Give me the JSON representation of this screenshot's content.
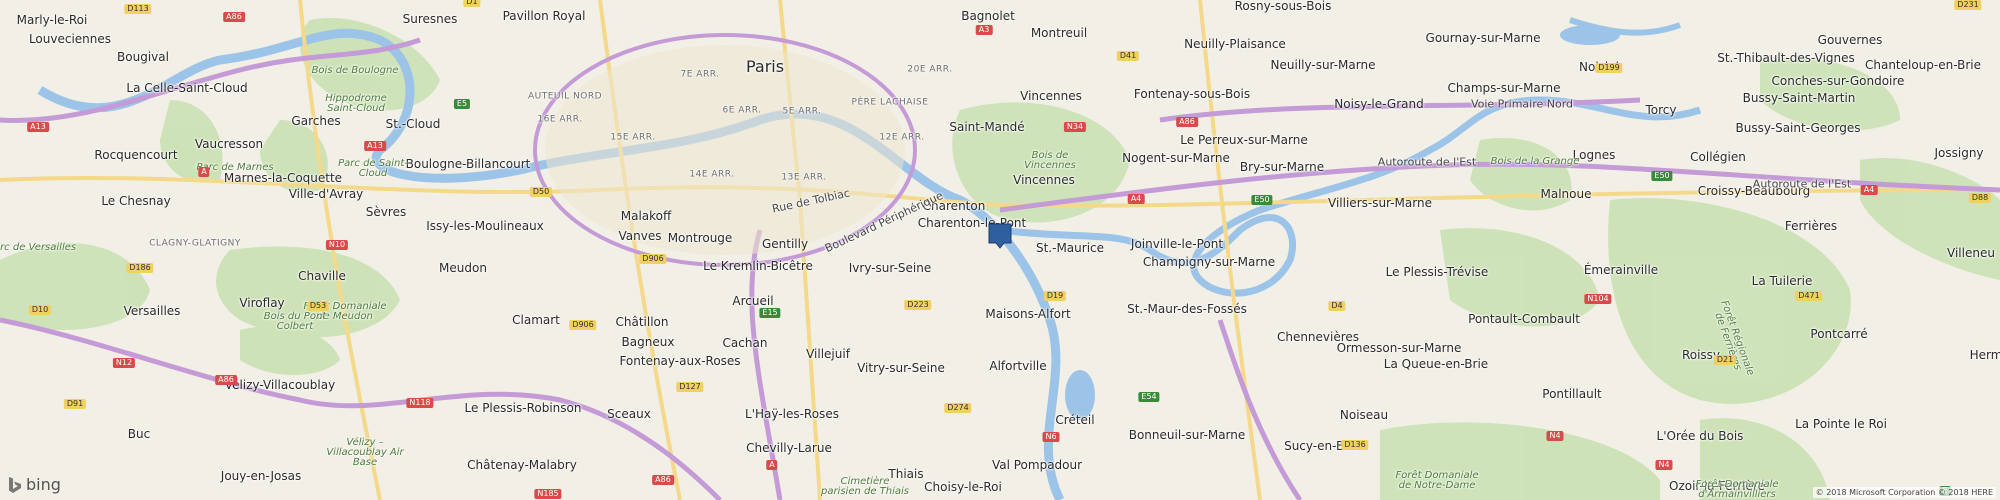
{
  "map": {
    "logo_text": "bing",
    "copyright": "© 2018 Microsoft Corporation © 2018 HERE",
    "colors": {
      "land": "#f2efe6",
      "park": "#c8e0b0",
      "water": "#9cc3e8",
      "motorway": "#c49bd6",
      "major_road": "#f5d98a"
    },
    "marker": {
      "icon": "location-pin-icon",
      "color": "#2f5f9e"
    },
    "labels": [
      {
        "id": "marly-le-roi",
        "text": "Marly-le-Roi",
        "kind": "town"
      },
      {
        "id": "louveciennes",
        "text": "Louveciennes",
        "kind": "town"
      },
      {
        "id": "bougival",
        "text": "Bougival",
        "kind": "town"
      },
      {
        "id": "la-celle-saint-cloud",
        "text": "La Celle-Saint-Cloud",
        "kind": "town"
      },
      {
        "id": "suresnes",
        "text": "Suresnes",
        "kind": "town"
      },
      {
        "id": "pavillon-royal",
        "text": "Pavillon Royal",
        "kind": "town"
      },
      {
        "id": "garches",
        "text": "Garches",
        "kind": "town"
      },
      {
        "id": "vaucresson",
        "text": "Vaucresson",
        "kind": "town"
      },
      {
        "id": "rocquencourt",
        "text": "Rocquencourt",
        "kind": "town"
      },
      {
        "id": "marnes-la-coquette",
        "text": "Marnes-la-Coquette",
        "kind": "town"
      },
      {
        "id": "ville-d-avray",
        "text": "Ville-d'Avray",
        "kind": "town"
      },
      {
        "id": "le-chesnay",
        "text": "Le Chesnay",
        "kind": "town"
      },
      {
        "id": "st-cloud",
        "text": "St.-Cloud",
        "kind": "town"
      },
      {
        "id": "boulogne-billancourt",
        "text": "Boulogne-Billancourt",
        "kind": "town"
      },
      {
        "id": "sevres",
        "text": "Sèvres",
        "kind": "town"
      },
      {
        "id": "chaville",
        "text": "Chaville",
        "kind": "town"
      },
      {
        "id": "versailles",
        "text": "Versailles",
        "kind": "town"
      },
      {
        "id": "viroflay",
        "text": "Viroflay",
        "kind": "town"
      },
      {
        "id": "issy",
        "text": "Issy-les-Moulineaux",
        "kind": "town"
      },
      {
        "id": "meudon",
        "text": "Meudon",
        "kind": "town"
      },
      {
        "id": "clamart",
        "text": "Clamart",
        "kind": "town"
      },
      {
        "id": "velizy",
        "text": "Vélizy-Villacoublay",
        "kind": "town"
      },
      {
        "id": "buc",
        "text": "Buc",
        "kind": "town"
      },
      {
        "id": "jouy",
        "text": "Jouy-en-Josas",
        "kind": "town"
      },
      {
        "id": "le-plessis-robinson",
        "text": "Le Plessis-Robinson",
        "kind": "town"
      },
      {
        "id": "chatenay",
        "text": "Châtenay-Malabry",
        "kind": "town"
      },
      {
        "id": "sceaux",
        "text": "Sceaux",
        "kind": "town"
      },
      {
        "id": "chatillon",
        "text": "Châtillon",
        "kind": "town"
      },
      {
        "id": "bagneux",
        "text": "Bagneux",
        "kind": "town"
      },
      {
        "id": "fontenay-aux-roses",
        "text": "Fontenay-aux-Roses",
        "kind": "town"
      },
      {
        "id": "malakoff",
        "text": "Malakoff",
        "kind": "town"
      },
      {
        "id": "vanves",
        "text": "Vanves",
        "kind": "town"
      },
      {
        "id": "montrouge",
        "text": "Montrouge",
        "kind": "town"
      },
      {
        "id": "gentilly",
        "text": "Gentilly",
        "kind": "town"
      },
      {
        "id": "kremlin",
        "text": "Le Kremlin-Bicêtre",
        "kind": "town"
      },
      {
        "id": "arcueil",
        "text": "Arcueil",
        "kind": "town"
      },
      {
        "id": "cachan",
        "text": "Cachan",
        "kind": "town"
      },
      {
        "id": "lhay",
        "text": "L'Haÿ-les-Roses",
        "kind": "town"
      },
      {
        "id": "chevilly",
        "text": "Chevilly-Larue",
        "kind": "town"
      },
      {
        "id": "villejuif",
        "text": "Villejuif",
        "kind": "town"
      },
      {
        "id": "ivry",
        "text": "Ivry-sur-Seine",
        "kind": "town"
      },
      {
        "id": "vitry",
        "text": "Vitry-sur-Seine",
        "kind": "town"
      },
      {
        "id": "thiais",
        "text": "Thiais",
        "kind": "town"
      },
      {
        "id": "choisy",
        "text": "Choisy-le-Roi",
        "kind": "town"
      },
      {
        "id": "paris",
        "text": "Paris",
        "kind": "city"
      },
      {
        "id": "bagnolet",
        "text": "Bagnolet",
        "kind": "town"
      },
      {
        "id": "montreuil",
        "text": "Montreuil",
        "kind": "town"
      },
      {
        "id": "vincennes-n",
        "text": "Vincennes",
        "kind": "town"
      },
      {
        "id": "saint-mande",
        "text": "Saint-Mandé",
        "kind": "town"
      },
      {
        "id": "vincennes-s",
        "text": "Vincennes",
        "kind": "town"
      },
      {
        "id": "charenton",
        "text": "Charenton",
        "kind": "town"
      },
      {
        "id": "charenton-le-pont",
        "text": "Charenton-le-Pont",
        "kind": "town"
      },
      {
        "id": "st-maurice",
        "text": "St.-Maurice",
        "kind": "town"
      },
      {
        "id": "maisons-alfort",
        "text": "Maisons-Alfort",
        "kind": "town"
      },
      {
        "id": "alfortville",
        "text": "Alfortville",
        "kind": "town"
      },
      {
        "id": "creteil",
        "text": "Créteil",
        "kind": "town"
      },
      {
        "id": "val-pompadour",
        "text": "Val Pompadour",
        "kind": "town"
      },
      {
        "id": "joinville",
        "text": "Joinville-le-Pont",
        "kind": "town"
      },
      {
        "id": "st-maur",
        "text": "St.-Maur-des-Fossés",
        "kind": "town"
      },
      {
        "id": "bonneuil",
        "text": "Bonneuil-sur-Marne",
        "kind": "town"
      },
      {
        "id": "sucy",
        "text": "Sucy-en-Brie",
        "kind": "town"
      },
      {
        "id": "fontenay-sous-bois",
        "text": "Fontenay-sous-Bois",
        "kind": "town"
      },
      {
        "id": "nogent",
        "text": "Nogent-sur-Marne",
        "kind": "town"
      },
      {
        "id": "le-perreux",
        "text": "Le Perreux-sur-Marne",
        "kind": "town"
      },
      {
        "id": "neuilly-plaisance",
        "text": "Neuilly-Plaisance",
        "kind": "town"
      },
      {
        "id": "neuilly-sur-marne",
        "text": "Neuilly-sur-Marne",
        "kind": "town"
      },
      {
        "id": "rosny",
        "text": "Rosny-sous-Bois",
        "kind": "town"
      },
      {
        "id": "bry",
        "text": "Bry-sur-Marne",
        "kind": "town"
      },
      {
        "id": "villiers",
        "text": "Villiers-sur-Marne",
        "kind": "town"
      },
      {
        "id": "champigny",
        "text": "Champigny-sur-Marne",
        "kind": "town"
      },
      {
        "id": "chennevieres",
        "text": "Chennevières",
        "kind": "town"
      },
      {
        "id": "ormesson",
        "text": "Ormesson-sur-Marne",
        "kind": "town"
      },
      {
        "id": "noiseau",
        "text": "Noiseau",
        "kind": "town"
      },
      {
        "id": "le-plessis-trevise",
        "text": "Le Plessis-Trévise",
        "kind": "town"
      },
      {
        "id": "la-queue",
        "text": "La Queue-en-Brie",
        "kind": "town"
      },
      {
        "id": "noisy-le-grand",
        "text": "Noisy-le-Grand",
        "kind": "town"
      },
      {
        "id": "gournay",
        "text": "Gournay-sur-Marne",
        "kind": "town"
      },
      {
        "id": "champs",
        "text": "Champs-sur-Marne",
        "kind": "town"
      },
      {
        "id": "noisiel",
        "text": "Noisiel",
        "kind": "town"
      },
      {
        "id": "malnoue",
        "text": "Malnoue",
        "kind": "town"
      },
      {
        "id": "emerainville",
        "text": "Émerainville",
        "kind": "town"
      },
      {
        "id": "pontault",
        "text": "Pontault-Combault",
        "kind": "town"
      },
      {
        "id": "pontillault",
        "text": "Pontillault",
        "kind": "town"
      },
      {
        "id": "lognes",
        "text": "Lognes",
        "kind": "town"
      },
      {
        "id": "torcy",
        "text": "Torcy",
        "kind": "town"
      },
      {
        "id": "st-thibault",
        "text": "St.-Thibault-des-Vignes",
        "kind": "town"
      },
      {
        "id": "gouvernes",
        "text": "Gouvernes",
        "kind": "town"
      },
      {
        "id": "conches",
        "text": "Conches-sur-Gondoire",
        "kind": "town"
      },
      {
        "id": "chanteloup",
        "text": "Chanteloup-en-Brie",
        "kind": "town"
      },
      {
        "id": "bussy-st-martin",
        "text": "Bussy-Saint-Martin",
        "kind": "town"
      },
      {
        "id": "bussy-st-georges",
        "text": "Bussy-Saint-Georges",
        "kind": "town"
      },
      {
        "id": "collegien",
        "text": "Collégien",
        "kind": "town"
      },
      {
        "id": "croissy",
        "text": "Croissy-Beaubourg",
        "kind": "town"
      },
      {
        "id": "jossigny",
        "text": "Jossigny",
        "kind": "town"
      },
      {
        "id": "ferrieres",
        "text": "Ferrières",
        "kind": "town"
      },
      {
        "id": "la-tuilerie",
        "text": "La Tuilerie",
        "kind": "town"
      },
      {
        "id": "pontcarre",
        "text": "Pontcarré",
        "kind": "town"
      },
      {
        "id": "roissy",
        "text": "Roissy",
        "kind": "town"
      },
      {
        "id": "la-pointe",
        "text": "La Pointe le Roi",
        "kind": "town"
      },
      {
        "id": "l-oree",
        "text": "L'Orée du Bois",
        "kind": "town"
      },
      {
        "id": "ozoir",
        "text": "Ozoir-la-Ferrière",
        "kind": "town"
      },
      {
        "id": "villeneu",
        "text": "Villeneu",
        "kind": "town"
      },
      {
        "id": "herm",
        "text": "Herm",
        "kind": "town"
      },
      {
        "id": "rue-tolbiac",
        "text": "Rue de Tolbiac",
        "kind": "road"
      },
      {
        "id": "boulevard-peripherique",
        "text": "Boulevard Périphérique",
        "kind": "road"
      },
      {
        "id": "autoroute-est-1",
        "text": "Autoroute de l'Est",
        "kind": "road"
      },
      {
        "id": "autoroute-est-2",
        "text": "Autoroute de l'Est",
        "kind": "road"
      },
      {
        "id": "voie-primaire",
        "text": "Voie Primaire Nord",
        "kind": "road"
      },
      {
        "id": "bois-boulogne",
        "text": "Bois de Boulogne",
        "kind": "area"
      },
      {
        "id": "bois-vincennes",
        "text": "Bois de Vincennes",
        "kind": "area"
      },
      {
        "id": "hippodrome",
        "text": "Hippodrome Saint-Cloud",
        "kind": "area"
      },
      {
        "id": "parc-st-cloud",
        "text": "Parc de Saint-Cloud",
        "kind": "area"
      },
      {
        "id": "parc-marnes",
        "text": "Parc de Marnes",
        "kind": "area"
      },
      {
        "id": "parc-versailles",
        "text": "Parc de Versailles",
        "kind": "area"
      },
      {
        "id": "foret-meudon",
        "text": "Forêt Domaniale de Meudon",
        "kind": "area"
      },
      {
        "id": "bois-pont-colbert",
        "text": "Bois du Pont Colbert",
        "kind": "area"
      },
      {
        "id": "velizy-air-base",
        "text": "Vélizy – Villacoublay Air Base",
        "kind": "area"
      },
      {
        "id": "bois-grange",
        "text": "Bois de la Grange",
        "kind": "area"
      },
      {
        "id": "foret-notre-dame",
        "text": "Forêt Domaniale de Notre-Dame",
        "kind": "area"
      },
      {
        "id": "foret-ferrieres",
        "text": "Forêt Régionale de Ferrières",
        "kind": "area"
      },
      {
        "id": "foret-armainvilliers",
        "text": "Forêt Domaniale d'Armainvilliers",
        "kind": "area"
      },
      {
        "id": "cimetiere-parisien",
        "text": "Cimetière parisien de Thiais",
        "kind": "area"
      },
      {
        "id": "pere-lachaise",
        "text": "PÈRE LACHAISE",
        "kind": "district"
      },
      {
        "id": "auteuil-nord",
        "text": "AUTEUIL NORD",
        "kind": "district"
      },
      {
        "id": "clagny",
        "text": "CLAGNY-GLATIGNY",
        "kind": "district"
      },
      {
        "id": "arr-7",
        "text": "7E ARR.",
        "kind": "district"
      },
      {
        "id": "arr-6",
        "text": "6E ARR.",
        "kind": "district"
      },
      {
        "id": "arr-5",
        "text": "5E ARR.",
        "kind": "district"
      },
      {
        "id": "arr-15",
        "text": "15E ARR.",
        "kind": "district"
      },
      {
        "id": "arr-14",
        "text": "14E ARR.",
        "kind": "district"
      },
      {
        "id": "arr-13",
        "text": "13E ARR.",
        "kind": "district"
      },
      {
        "id": "arr-12",
        "text": "12E ARR.",
        "kind": "district"
      },
      {
        "id": "arr-16",
        "text": "16E ARR.",
        "kind": "district"
      },
      {
        "id": "arr-20",
        "text": "20E ARR.",
        "kind": "district"
      }
    ],
    "shields": [
      {
        "id": "a86-nw",
        "text": "A86",
        "color": "red"
      },
      {
        "id": "d113",
        "text": "D113",
        "color": "yellow"
      },
      {
        "id": "d1",
        "text": "D1",
        "color": "yellow"
      },
      {
        "id": "a13",
        "text": "A13",
        "color": "red"
      },
      {
        "id": "e5",
        "text": "E5",
        "color": "green"
      },
      {
        "id": "a13-2",
        "text": "A13",
        "color": "red"
      },
      {
        "id": "a-sign",
        "text": "A",
        "color": "red"
      },
      {
        "id": "d50",
        "text": "D50",
        "color": "yellow"
      },
      {
        "id": "n10",
        "text": "N10",
        "color": "red"
      },
      {
        "id": "d186",
        "text": "D186",
        "color": "yellow"
      },
      {
        "id": "d10",
        "text": "D10",
        "color": "yellow"
      },
      {
        "id": "d53",
        "text": "D53",
        "color": "yellow"
      },
      {
        "id": "n12",
        "text": "N12",
        "color": "red"
      },
      {
        "id": "a86-sw",
        "text": "A86",
        "color": "red"
      },
      {
        "id": "d91",
        "text": "D91",
        "color": "yellow"
      },
      {
        "id": "n118",
        "text": "N118",
        "color": "red"
      },
      {
        "id": "d906",
        "text": "D906",
        "color": "yellow"
      },
      {
        "id": "d906-2",
        "text": "D906",
        "color": "yellow"
      },
      {
        "id": "d127",
        "text": "D127",
        "color": "yellow"
      },
      {
        "id": "e15",
        "text": "E15",
        "color": "green"
      },
      {
        "id": "a6",
        "text": "A",
        "color": "red"
      },
      {
        "id": "n185",
        "text": "N185",
        "color": "red"
      },
      {
        "id": "a86-s",
        "text": "A86",
        "color": "red"
      },
      {
        "id": "d223",
        "text": "D223",
        "color": "yellow"
      },
      {
        "id": "d274",
        "text": "D274",
        "color": "yellow"
      },
      {
        "id": "a3",
        "text": "A3",
        "color": "red"
      },
      {
        "id": "n34",
        "text": "N34",
        "color": "red"
      },
      {
        "id": "d41",
        "text": "D41",
        "color": "yellow"
      },
      {
        "id": "a86-e",
        "text": "A86",
        "color": "red"
      },
      {
        "id": "a4",
        "text": "A4",
        "color": "red"
      },
      {
        "id": "d19",
        "text": "D19",
        "color": "yellow"
      },
      {
        "id": "n6",
        "text": "N6",
        "color": "red"
      },
      {
        "id": "e54",
        "text": "E54",
        "color": "green"
      },
      {
        "id": "e50",
        "text": "E50",
        "color": "green"
      },
      {
        "id": "d4",
        "text": "D4",
        "color": "yellow"
      },
      {
        "id": "d136",
        "text": "D136",
        "color": "yellow"
      },
      {
        "id": "d199",
        "text": "D199",
        "color": "yellow"
      },
      {
        "id": "e50-2",
        "text": "E50",
        "color": "green"
      },
      {
        "id": "a4-2",
        "text": "A4",
        "color": "red"
      },
      {
        "id": "n104",
        "text": "N104",
        "color": "red"
      },
      {
        "id": "n4",
        "text": "N4",
        "color": "red"
      },
      {
        "id": "n4-2",
        "text": "N4",
        "color": "red"
      },
      {
        "id": "d21",
        "text": "D21",
        "color": "yellow"
      },
      {
        "id": "d471",
        "text": "D471",
        "color": "yellow"
      },
      {
        "id": "d88",
        "text": "D88",
        "color": "yellow"
      },
      {
        "id": "d231",
        "text": "D231",
        "color": "yellow"
      },
      {
        "id": "e-sign",
        "text": "E",
        "color": "green"
      }
    ]
  }
}
